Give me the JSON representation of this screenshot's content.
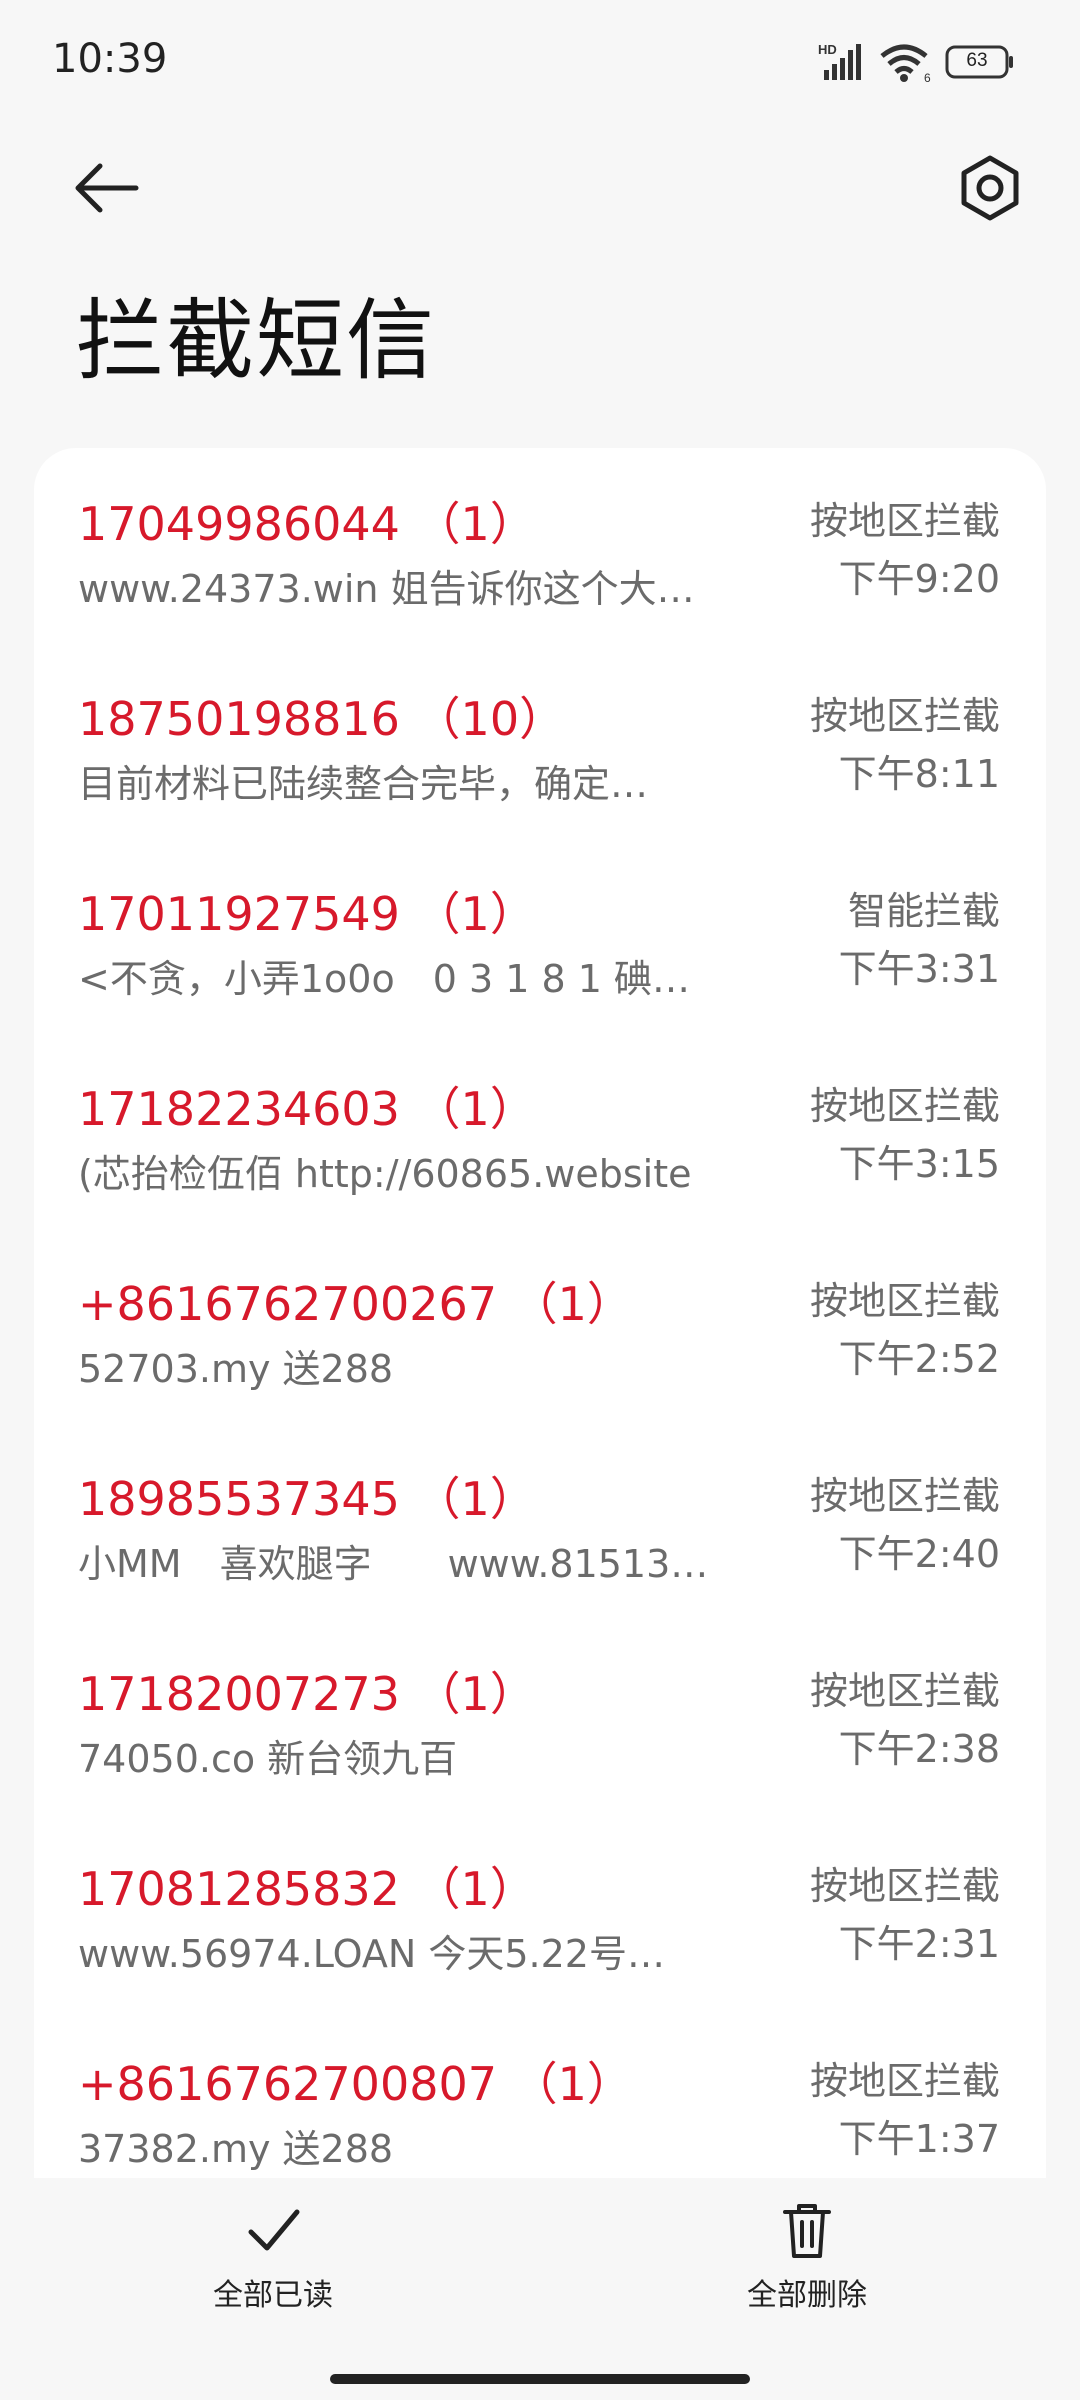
{
  "status_bar": {
    "time": "10:39",
    "battery": "63",
    "icons": [
      "hd-signal-icon",
      "wifi-icon",
      "battery-icon"
    ]
  },
  "header": {
    "back_icon": "back-arrow-icon",
    "settings_icon": "settings-hex-icon",
    "title": "拦截短信"
  },
  "colors": {
    "number_red": "#d7192b",
    "secondary_text": "#6b6b6b",
    "card_bg": "#ffffff",
    "page_bg": "#f7f7f7"
  },
  "messages": [
    {
      "number": "17049986044 （1）",
      "preview": "www.24373.win 姐告诉你这个大…",
      "type": "按地区拦截",
      "time": "下午9:20"
    },
    {
      "number": "18750198816 （10）",
      "preview": "目前材料已陆续整合完毕，确定…",
      "type": "按地区拦截",
      "time": "下午8:11"
    },
    {
      "number": "17011927549 （1）",
      "preview": "<不贪，小弄1o0o　0 3 1 8 1 碘…",
      "type": "智能拦截",
      "time": "下午3:31"
    },
    {
      "number": "17182234603 （1）",
      "preview": "(芯抬检伍佰 http://60865.website",
      "type": "按地区拦截",
      "time": "下午3:15"
    },
    {
      "number": "+8616762700267 （1）",
      "preview": "52703.my  送288",
      "type": "按地区拦截",
      "time": "下午2:52"
    },
    {
      "number": "18985537345 （1）",
      "preview": "小MM　喜欢腿字　　www.81513…",
      "type": "按地区拦截",
      "time": "下午2:40"
    },
    {
      "number": "17182007273 （1）",
      "preview": "74050.co  新台领九百",
      "type": "按地区拦截",
      "time": "下午2:38"
    },
    {
      "number": "17081285832 （1）",
      "preview": "www.56974.LOAN  今天5.22号…",
      "type": "按地区拦截",
      "time": "下午2:31"
    },
    {
      "number": "+8616762700807 （1）",
      "preview": "37382.my 送288",
      "type": "按地区拦截",
      "time": "下午1:37"
    }
  ],
  "bottom_actions": {
    "mark_all_read": {
      "label": "全部已读",
      "icon": "checkmark-icon"
    },
    "delete_all": {
      "label": "全部删除",
      "icon": "trash-icon"
    }
  }
}
